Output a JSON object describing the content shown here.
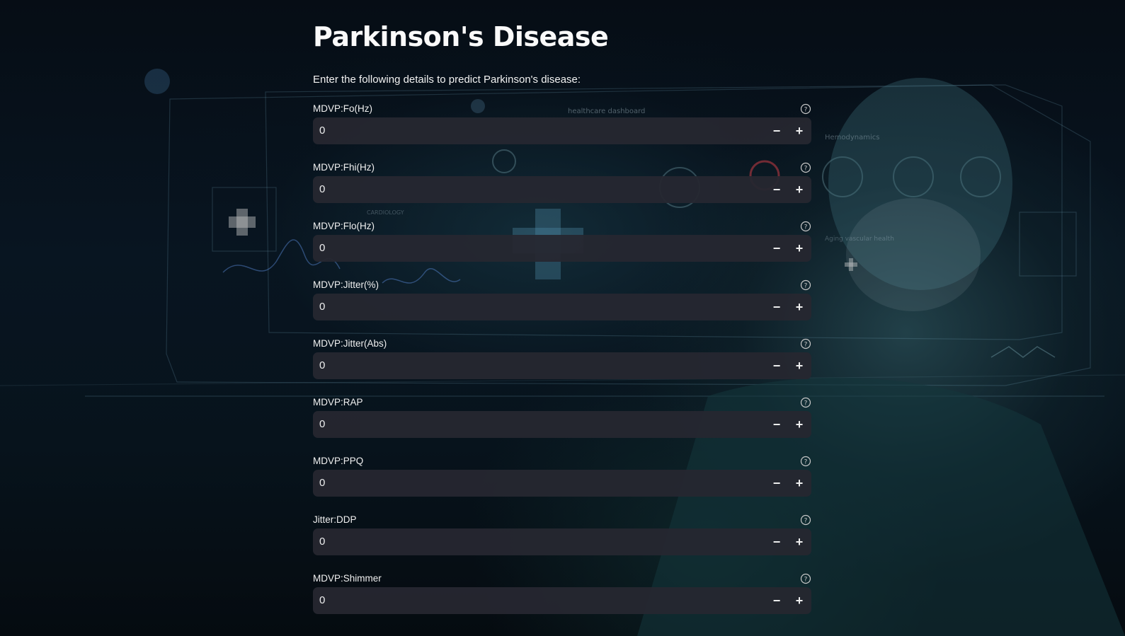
{
  "page": {
    "title": "Parkinson's Disease",
    "subtitle": "Enter the following details to predict Parkinson's disease:"
  },
  "background": {
    "dashboard_header": "healthcare dashboard",
    "hemodynamics": "Hemodynamics",
    "cardiology": "CARDIOLOGY",
    "aging_vascular_health": "Aging vascular health",
    "accent_color": "#0d2a36"
  },
  "fields": [
    {
      "label": "MDVP:Fo(Hz)",
      "value": "0"
    },
    {
      "label": "MDVP:Fhi(Hz)",
      "value": "0"
    },
    {
      "label": "MDVP:Flo(Hz)",
      "value": "0"
    },
    {
      "label": "MDVP:Jitter(%)",
      "value": "0"
    },
    {
      "label": "MDVP:Jitter(Abs)",
      "value": "0"
    },
    {
      "label": "MDVP:RAP",
      "value": "0"
    },
    {
      "label": "MDVP:PPQ",
      "value": "0"
    },
    {
      "label": "Jitter:DDP",
      "value": "0"
    },
    {
      "label": "MDVP:Shimmer",
      "value": "0"
    }
  ],
  "controls": {
    "minus": "−",
    "plus": "+",
    "help_icon": "question-circle-icon"
  },
  "colors": {
    "input_bg": "#262730",
    "text": "#fafafa"
  }
}
